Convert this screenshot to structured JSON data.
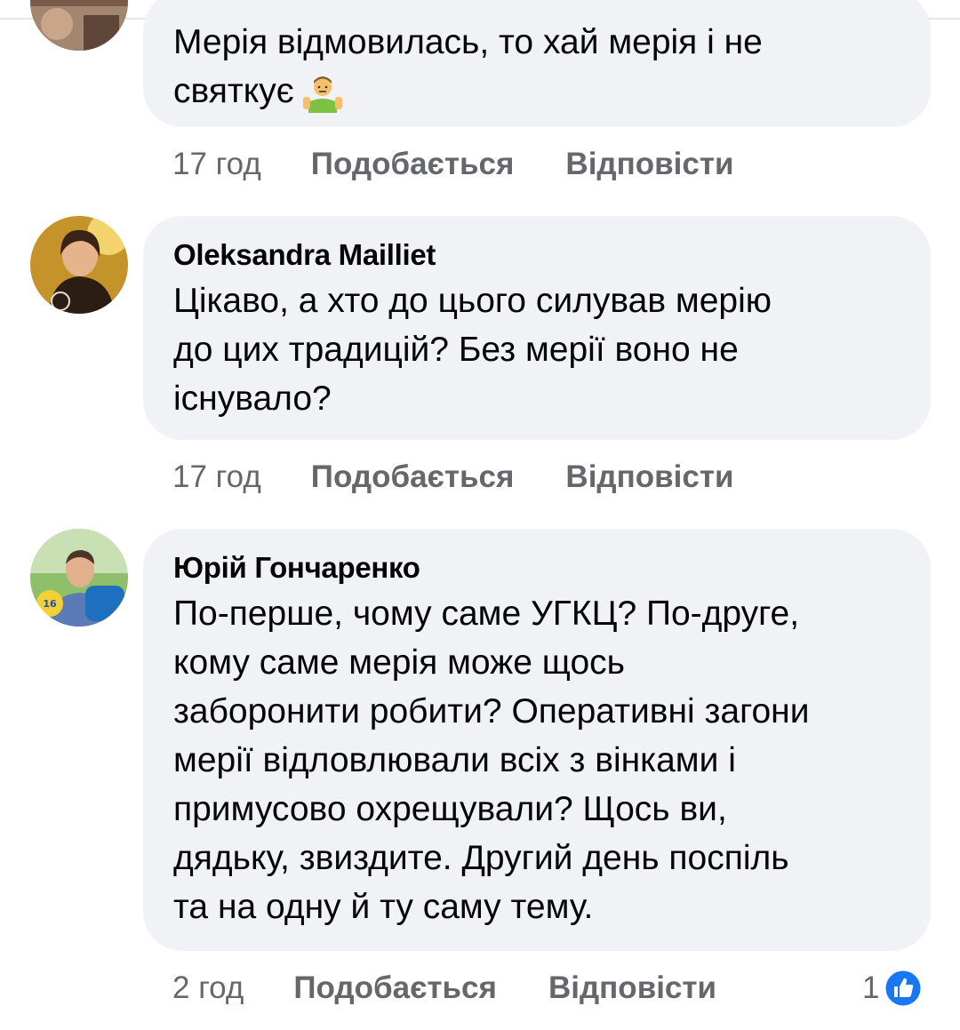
{
  "comments": [
    {
      "author": "",
      "text_line1": "Мерія відмовилась, то хай мерія і не",
      "text_line2": "святкує",
      "emoji": "man-shrugging-emoji",
      "time": "17 год",
      "like_label": "Подобається",
      "reply_label": "Відповісти"
    },
    {
      "author": "Oleksandra Mailliet",
      "text_lines": [
        "Цікаво, а хто до цього силував мерію",
        "до цих традицій? Без мерії воно не",
        "існувало?"
      ],
      "time": "17 год",
      "like_label": "Подобається",
      "reply_label": "Відповісти"
    },
    {
      "author": "Юрій Гончаренко",
      "text_lines": [
        "По-перше, чому саме УГКЦ? По-друге,",
        "кому саме мерія може щось",
        "заборонити робити? Оперативні загони",
        "мерії відловлювали всіх з вінками і",
        "примусово охрещували? Щось ви,",
        "дядьку, звиздите. Другий день поспіль",
        "та на одну й ту саму тему."
      ],
      "time": "2 год",
      "like_label": "Подобається",
      "reply_label": "Відповісти",
      "reaction_count": "1",
      "reaction_icon": "like-icon"
    }
  ],
  "colors": {
    "bubble": "#f0f2f5",
    "meta_text": "#65676b",
    "like_blue": "#1877f2"
  }
}
